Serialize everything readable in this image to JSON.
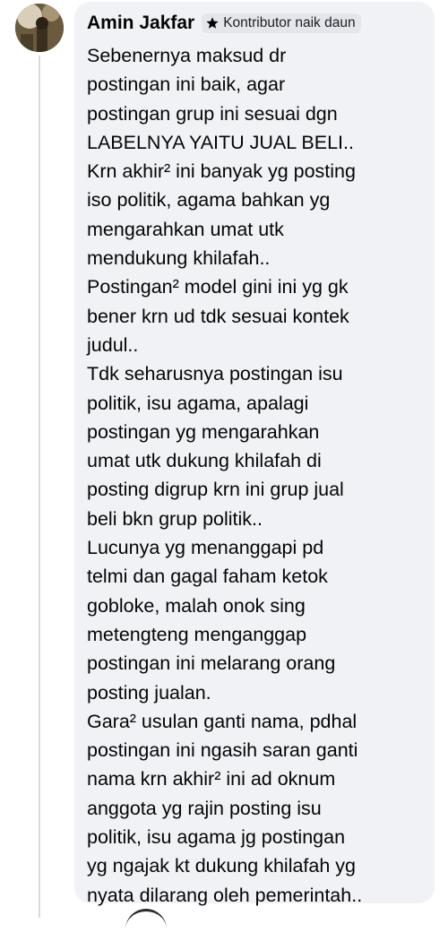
{
  "comment": {
    "author": "Amin Jakfar",
    "badge": {
      "icon": "star-icon",
      "label": "Kontributor naik daun"
    },
    "text": "Sebenernya maksud dr\npostingan ini baik, agar\npostingan grup ini sesuai dgn\nLABELNYA YAITU JUAL BELI..\nKrn akhir² ini banyak yg posting\niso politik, agama bahkan yg\nmengarahkan umat utk\nmendukung khilafah..\nPostingan² model gini ini yg gk\nbener krn ud tdk sesuai kontek\njudul..\nTdk seharusnya postingan isu\npolitik, isu agama, apalagi\npostingan yg mengarahkan\numat utk dukung khilafah di\nposting digrup krn ini grup jual\nbeli bkn grup politik..\nLucunya yg menanggapi pd\ntelmi dan gagal faham ketok\ngobloke, malah onok sing\nmetengteng menganggap\npostingan ini melarang orang\nposting jualan.\nGara² usulan ganti nama, pdhal\npostingan ini ngasih saran ganti\nnama krn akhir² ini ad oknum\nanggota yg rajin posting isu\npolitik, isu agama jg postingan\nyg ngajak kt dukung khilafah yg\nnyata dilarang oleh pemerintah.."
  },
  "colors": {
    "bubble_background": "#f0f2f5",
    "badge_background": "#e4e6eb",
    "text": "#050505",
    "thread_line": "#d8dadf"
  }
}
